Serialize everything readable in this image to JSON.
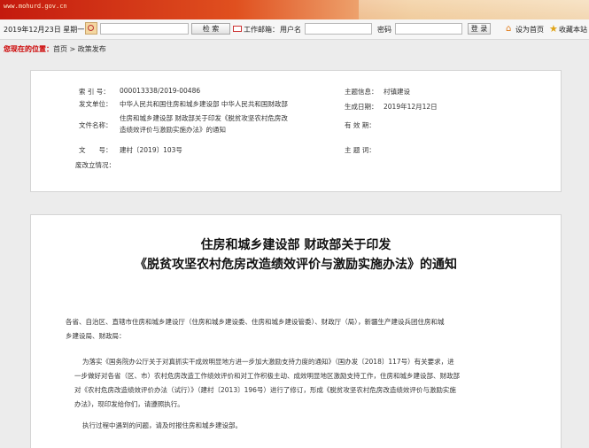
{
  "banner": {
    "url": "www.mohurd.gov.cn"
  },
  "toolbar": {
    "date": "2019年12月23日 星期一",
    "search_button": "检 索",
    "mail_label": "工作邮箱：",
    "user_label": "用户名",
    "password_label": "密码",
    "login_button": "登 录",
    "home_link": "设为首页",
    "favorite_link": "收藏本站"
  },
  "breadcrumb": {
    "here": "您现在的位置：",
    "path": "首页 > 政策发布"
  },
  "meta": {
    "index_no_label": "索 引 号：",
    "index_no": "000013338/2019-00486",
    "issuer_label": "发文单位：",
    "issuer": "中华人民共和国住房和城乡建设部 中华人民共和国财政部",
    "filename_label": "文件名称：",
    "filename_line1": "住房和城乡建设部 财政部关于印发《脱贫攻坚农村危房改",
    "filename_line2": "造绩效评价与激励实施办法》的通知",
    "docno_label": "文　　号：",
    "docno": "建村〔2019〕103号",
    "status_label": "废改立情况：",
    "category_label": "主题信息：",
    "category": "村镇建设",
    "date_label": "生成日期：",
    "date": "2019年12月12日",
    "valid_label": "有 效 期：",
    "keywords_label": "主 题 词："
  },
  "article": {
    "title_line1": "住房和城乡建设部 财政部关于印发",
    "title_line2": "《脱贫攻坚农村危房改造绩效评价与激励实施办法》的通知",
    "recipients_1": "各省、自治区、直辖市住房和城乡建设厅（住房和城乡建设委、住房和城乡建设管委）、财政厅（局），新疆生产建设兵团住房和城",
    "recipients_2": "乡建设局、财政局：",
    "body_1": "为落实《国务院办公厅关于对真抓实干成效明显地方进一步加大激励支持力度的通知》（国办发〔2018〕117号）有关要求，进",
    "body_2": "一步做好对各省（区、市）农村危房改造工作绩效评价和对工作积极主动、成效明显地区激励支持工作，住房和城乡建设部、财政部",
    "body_3": "对《农村危房改造绩效评价办法（试行）》（建村〔2013〕196号）进行了修订，形成《脱贫攻坚农村危房改造绩效评价与激励实施",
    "body_4": "办法》，现印发给你们，请遵照执行。",
    "body_5": "执行过程中遇到的问题，请及时报住房和城乡建设部。"
  }
}
